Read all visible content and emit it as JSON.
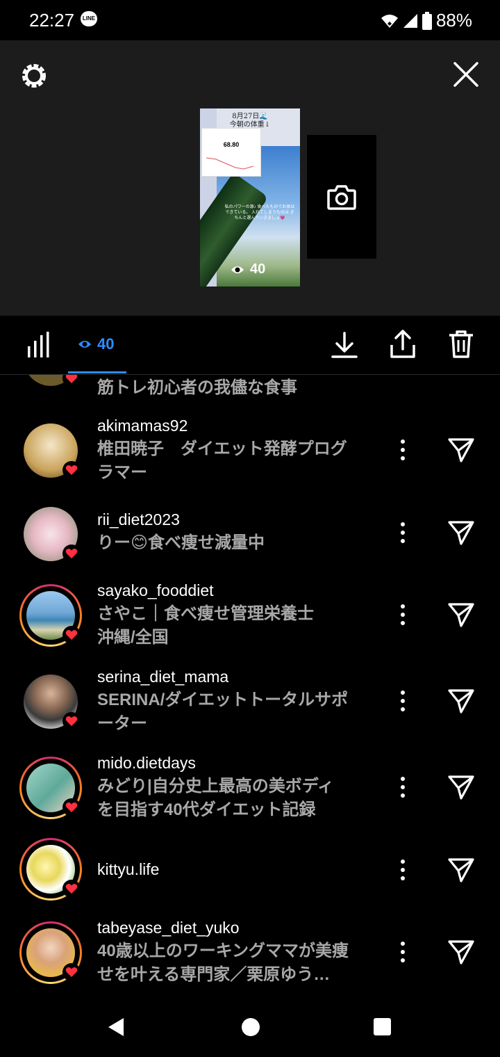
{
  "status_bar": {
    "time": "22:27",
    "notification": "LINE",
    "battery": "88%"
  },
  "story_preview": {
    "date_text": "8月27日🌊",
    "subtitle": "今朝の体重↓",
    "weight": "68.80",
    "caption": "私のパワーの源♪ 食べたものでお体はできている。 入れてしまうものは きちんと選んでいきましょ💗",
    "view_count": "40"
  },
  "action_bar": {
    "viewers_count": "40"
  },
  "viewers": [
    {
      "username": "",
      "fullname": "筋トレ初心者の我儘な食事",
      "ring": false,
      "avatar_color": "#6b5a2a"
    },
    {
      "username": "akimamas92",
      "fullname": "椎田暁子　ダイエット発酵プログラマー",
      "ring": false,
      "avatar_color": "#c9a35a"
    },
    {
      "username": "rii_diet2023",
      "fullname": "りー😊食べ痩せ減量中",
      "ring": false,
      "avatar_color": "#e6b8c4"
    },
    {
      "username": "sayako_fooddiet",
      "fullname": "さやこ｜食べ痩せ管理栄養士 沖縄/全国",
      "ring": true,
      "avatar_color": "#6fa7d6"
    },
    {
      "username": "serina_diet_mama",
      "fullname": "SERINA/ダイエットトータルサポーター",
      "ring": false,
      "avatar_color": "#3a3a3a"
    },
    {
      "username": "mido.dietdays",
      "fullname": "みどり|自分史上最高の美ボディを目指す40代ダイエット記録",
      "ring": true,
      "avatar_color": "#5fa99a"
    },
    {
      "username": "kittyu.life",
      "fullname": "",
      "ring": true,
      "avatar_color": "#e8d85c"
    },
    {
      "username": "tabeyase_diet_yuko",
      "fullname": "40歳以上のワーキングママが美痩せを叶える専門家／栗原ゆう…",
      "ring": true,
      "avatar_color": "#d9a27a"
    }
  ]
}
